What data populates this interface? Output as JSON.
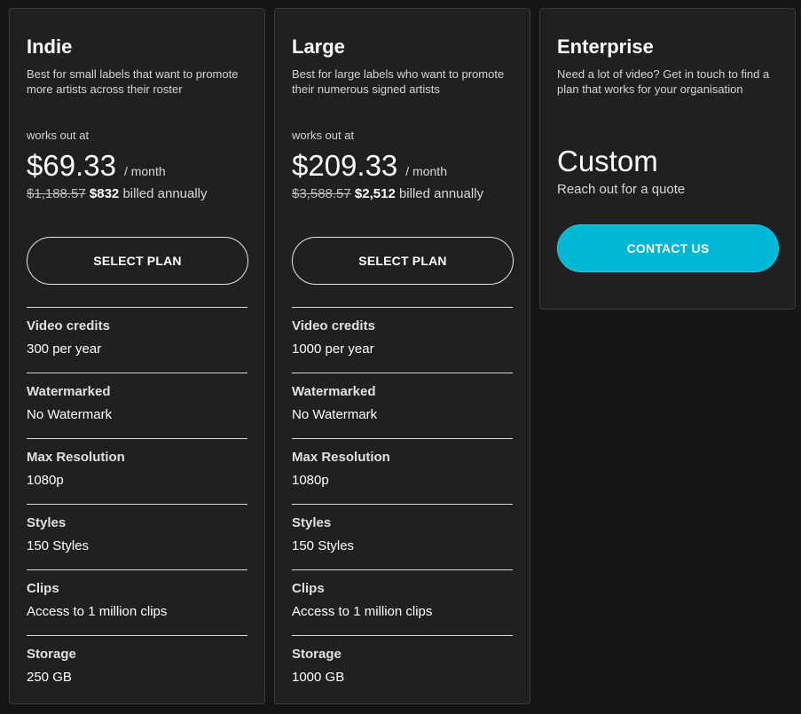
{
  "plans": [
    {
      "name": "Indie",
      "description": "Best for small labels that want to promote more artists across their roster",
      "works_label": "works out at",
      "price": "$69.33",
      "per": "/ month",
      "old_price": "$1,188.57",
      "new_price": "$832",
      "billed_suffix": " billed annually",
      "button_label": "SELECT PLAN",
      "features": [
        {
          "name": "Video credits",
          "value": "300 per year"
        },
        {
          "name": "Watermarked",
          "value": "No Watermark"
        },
        {
          "name": "Max Resolution",
          "value": "1080p"
        },
        {
          "name": "Styles",
          "value": "150 Styles"
        },
        {
          "name": "Clips",
          "value": "Access to 1 million clips"
        },
        {
          "name": "Storage",
          "value": "250 GB"
        }
      ]
    },
    {
      "name": "Large",
      "description": "Best for large labels who want to promote their numerous signed artists",
      "works_label": "works out at",
      "price": "$209.33",
      "per": "/ month",
      "old_price": "$3,588.57",
      "new_price": "$2,512",
      "billed_suffix": " billed annually",
      "button_label": "SELECT PLAN",
      "features": [
        {
          "name": "Video credits",
          "value": "1000 per year"
        },
        {
          "name": "Watermarked",
          "value": "No Watermark"
        },
        {
          "name": "Max Resolution",
          "value": "1080p"
        },
        {
          "name": "Styles",
          "value": "150 Styles"
        },
        {
          "name": "Clips",
          "value": "Access to 1 million clips"
        },
        {
          "name": "Storage",
          "value": "1000 GB"
        }
      ]
    }
  ],
  "enterprise": {
    "name": "Enterprise",
    "description": "Need a lot of video? Get in touch to find a plan that works for your organisation",
    "price": "Custom",
    "quote": "Reach out for a quote",
    "button_label": "CONTACT US"
  },
  "colors": {
    "accent": "#00b7d6",
    "card_bg": "#202020",
    "page_bg": "#161616"
  }
}
